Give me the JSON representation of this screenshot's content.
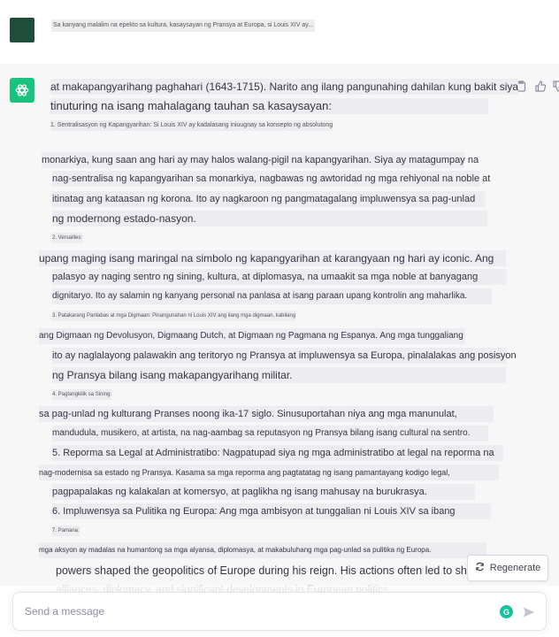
{
  "user_message": {
    "text": "Sa kanyang malalim na epekto sa kultura, kasaysayan ng Pransya at Europa, si Louis XIV ay..."
  },
  "assistant": {
    "lines": [
      "at makapangyarihang paghahari (1643-1715). Narito ang ilang pangunahing dahilan kung bakit siya",
      "tinuturing na isang mahalagang tauhan sa kasaysayan:",
      "1. Sentralisasyon ng Kapangyarihan: Si Louis XIV ay kadalasang iniuugnay sa konsepto ng absolutong",
      "monarkiya, kung saan ang hari ay may halos walang-pigil na kapangyarihan. Siya ay matagumpay na",
      "nag-sentralisa ng kapangyarihan sa monarkiya, nagbawas ng awtoridad ng mga rehiyonal na noble at",
      "itinatag ang kataasan ng korona. Ito ay nagkaroon ng pangmatagalang impluwensya sa pag-unlad",
      "ng modernong estado-nasyon.",
      "2. Versailles:",
      "upang maging isang maringal na simbolo ng kapangyarihan at karangyaan ng hari ay iconic. Ang",
      "palasyo ay naging sentro ng sining, kultura, at diplomasya, na umaakit sa mga noble at banyagang",
      "dignitaryo. Ito ay salamin ng kanyang personal na panlasa at isang paraan upang kontrolin ang maharlika.",
      "3. Patakarang Panlabas at mga Digmaan: Pinangunahan ni Louis XIV ang ilang mga digmaan, kabilang",
      "ang Digmaan ng Devolusyon, Digmaang Dutch, at Digmaan ng Pagmana ng Espanya. Ang mga tunggaliang",
      "ito ay naglalayong palawakin ang teritoryo ng Pransya at impluwensya sa Europa, pinalalakas ang posisyon",
      "ng Pransya bilang isang makapangyarihang militar.",
      "4. Pagtangkilik sa Sining:",
      "sa pag-unlad ng kulturang Pranses noong ika-17 siglo. Sinusuportahan niya ang mga manunulat,",
      "mandudula, musikero, at artista, na nag-aambag sa reputasyon ng Pransya bilang isang cultural na sentro.",
      "5. Reporma sa Legal at Administratibo: Nagpatupad siya ng mga administratibo at legal na reporma na",
      "nag-modernisa sa estado ng Pransya. Kasama sa mga reporma ang pagtatatag ng isang pamantayang kodigo legal,",
      "pagpapalakas ng kalakalan at komersyo, at paglikha ng isang mahusay na burukrasya.",
      "6. Impluwensya sa Pulitika ng Europa: Ang mga ambisyon at tunggalian ni Louis XIV sa ibang",
      "7. Pamana:",
      "mga aksyon ay madalas na humantong sa mga alyansa, diplomasya, at makabuluhang mga pag-unlad sa pulitika ng Europa.",
      "powers shaped the geopolitics of Europe during his reign. His actions often led to shifts in",
      "alliances, diplomacy, and significant developments in European politics."
    ]
  },
  "regenerate_label": "Regenerate",
  "input": {
    "placeholder": "Send a message"
  },
  "icons": {
    "assistant_avatar": "openai-logo-icon",
    "copy": "clipboard-icon",
    "like": "thumbs-up-icon",
    "dislike": "thumbs-down-icon",
    "regenerate": "refresh-icon",
    "send": "paper-plane-icon",
    "grammarly": "grammarly-icon"
  },
  "colors": {
    "assistant_avatar_bg": "#19c37d",
    "user_avatar_bg": "#1f4d3a",
    "assistant_row_bg": "#f7f7f8"
  }
}
